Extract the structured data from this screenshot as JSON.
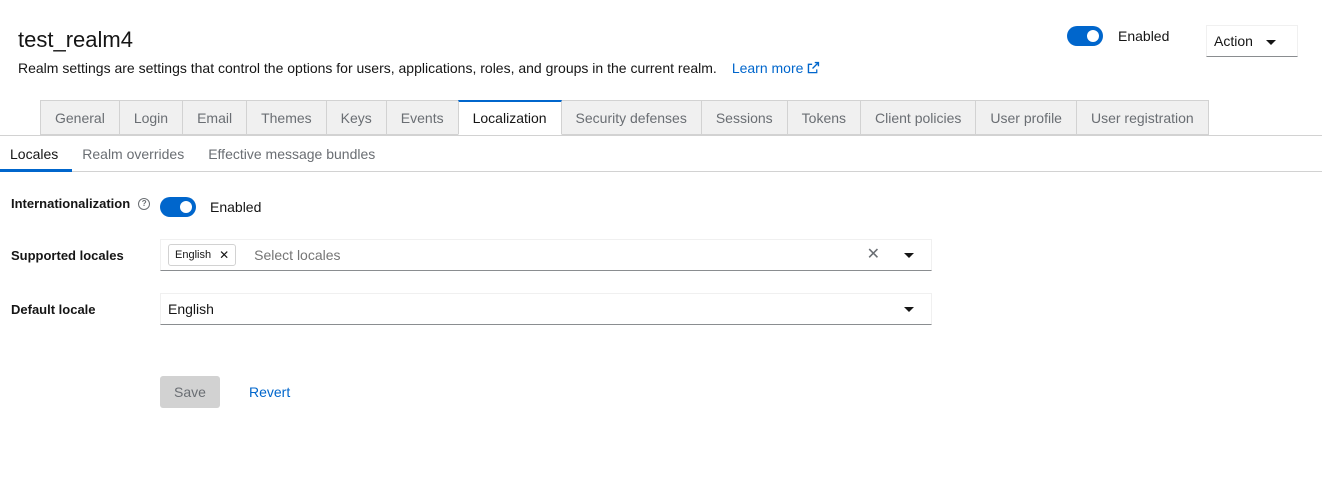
{
  "header": {
    "title": "test_realm4",
    "description": "Realm settings are settings that control the options for users, applications, roles, and groups in the current realm.",
    "learn_more": "Learn more",
    "enabled_label": "Enabled",
    "action_label": "Action"
  },
  "main_tabs": [
    {
      "label": "General"
    },
    {
      "label": "Login"
    },
    {
      "label": "Email"
    },
    {
      "label": "Themes"
    },
    {
      "label": "Keys"
    },
    {
      "label": "Events"
    },
    {
      "label": "Localization"
    },
    {
      "label": "Security defenses"
    },
    {
      "label": "Sessions"
    },
    {
      "label": "Tokens"
    },
    {
      "label": "Client policies"
    },
    {
      "label": "User profile"
    },
    {
      "label": "User registration"
    }
  ],
  "active_main_tab": "Localization",
  "sub_tabs": [
    {
      "label": "Locales"
    },
    {
      "label": "Realm overrides"
    },
    {
      "label": "Effective message bundles"
    }
  ],
  "form": {
    "internationalization_label": "Internationalization",
    "internationalization_value": "Enabled",
    "supported_locales_label": "Supported locales",
    "supported_locales_chip": "English",
    "supported_locales_placeholder": "Select locales",
    "default_locale_label": "Default locale",
    "default_locale_value": "English"
  },
  "buttons": {
    "save": "Save",
    "revert": "Revert"
  },
  "colors": {
    "accent": "#0066cc",
    "tab_bg": "#f0f0f0",
    "border": "#d2d2d2"
  }
}
